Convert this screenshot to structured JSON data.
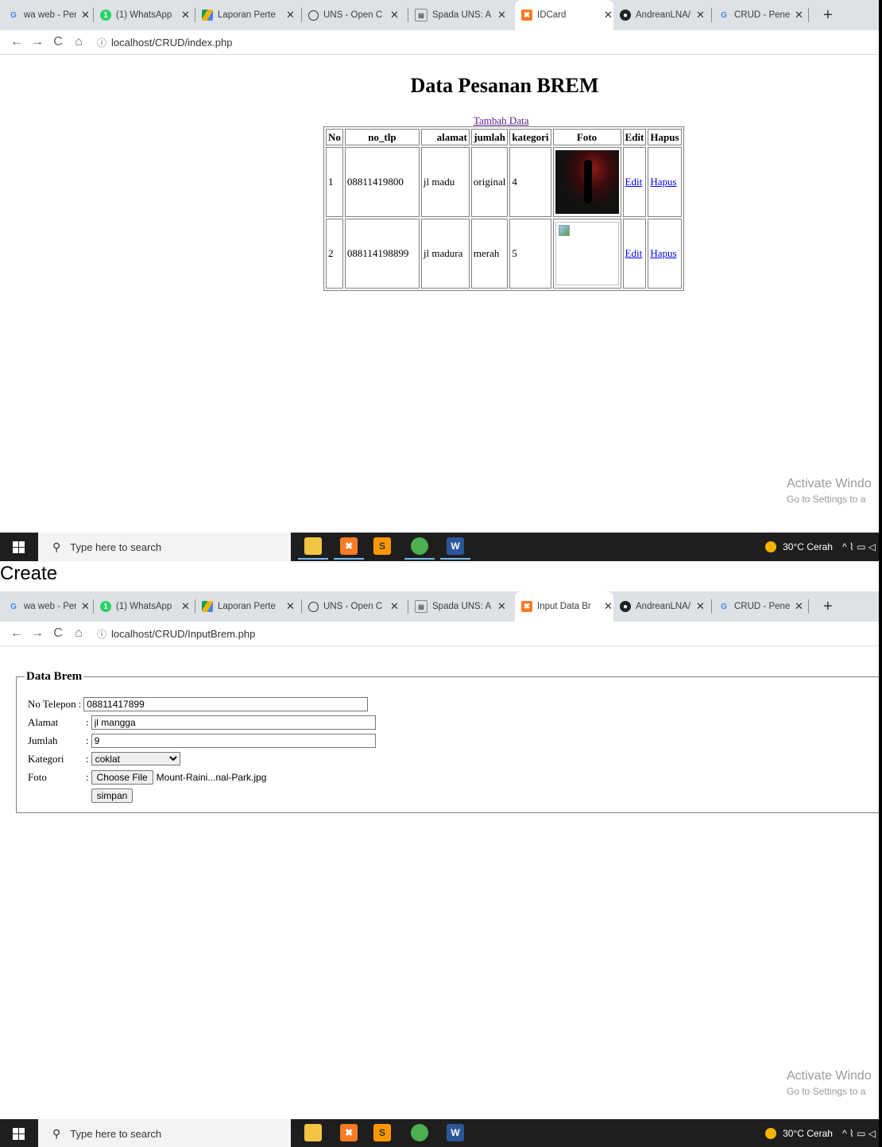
{
  "browser1": {
    "tabs": [
      {
        "label": "wa web - Pen",
        "icon": "google-g-icon"
      },
      {
        "label": "(1) WhatsApp",
        "icon": "whatsapp-icon"
      },
      {
        "label": "Laporan Perte",
        "icon": "google-drive-icon"
      },
      {
        "label": "UNS - Open C",
        "icon": "globe-icon"
      },
      {
        "label": "Spada UNS: A",
        "icon": "spada-icon"
      },
      {
        "label": "IDCard",
        "icon": "xampp-icon"
      },
      {
        "label": "AndreanLNA/",
        "icon": "github-icon"
      },
      {
        "label": "CRUD - Penel",
        "icon": "google-g-icon"
      }
    ],
    "url": "localhost/CRUD/index.php"
  },
  "index_page": {
    "title": "Data Pesanan BREM",
    "add_link": "Tambah Data",
    "headers": [
      "No",
      "no_tlp",
      "alamat",
      "jumlah",
      "kategori",
      "Foto",
      "Edit",
      "Hapus"
    ],
    "rows": [
      {
        "no": "1",
        "no_tlp": "08811419800",
        "alamat": "jl madu",
        "jumlah": "original",
        "kategori": "4",
        "edit": "Edit",
        "hapus": "Hapus"
      },
      {
        "no": "2",
        "no_tlp": "088114198899",
        "alamat": "jl madura",
        "jumlah": "merah",
        "kategori": "5",
        "edit": "Edit",
        "hapus": "Hapus"
      }
    ]
  },
  "watermark": {
    "line1": "Activate Windo",
    "line2": "Go to Settings to a"
  },
  "taskbar": {
    "search_placeholder": "Type here to search",
    "weather": "30°C  Cerah",
    "tray_symbols": "^  ⌇ ▭ ◁"
  },
  "section_label": "Create",
  "browser2": {
    "tab6_label": "Input Data Br",
    "url": "localhost/CRUD/InputBrem.php"
  },
  "form": {
    "legend": "Data Brem",
    "telepon_label": "No Telepon",
    "telepon_value": "08811417899",
    "alamat_label": "Alamat",
    "alamat_value": "jl mangga",
    "jumlah_label": "Jumlah",
    "jumlah_value": "9",
    "kategori_label": "Kategori",
    "kategori_value": "coklat",
    "foto_label": "Foto",
    "choose_file": "Choose File",
    "file_name": "Mount-Raini...nal-Park.jpg",
    "submit": "simpan"
  }
}
